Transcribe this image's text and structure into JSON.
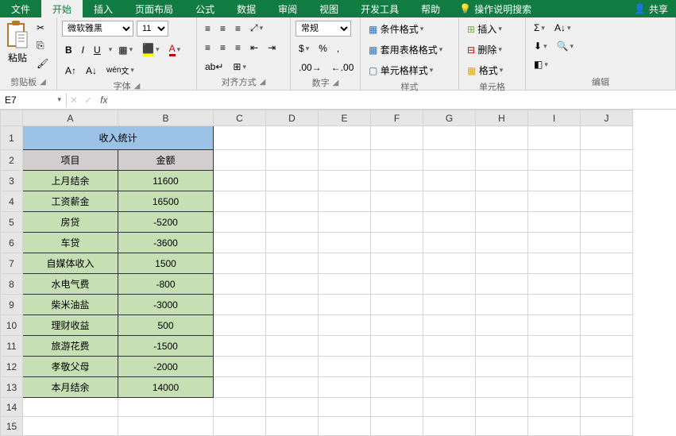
{
  "tabs": {
    "items": [
      "文件",
      "开始",
      "插入",
      "页面布局",
      "公式",
      "数据",
      "审阅",
      "视图",
      "开发工具",
      "帮助"
    ],
    "active_index": 1,
    "search_hint": "操作说明搜索",
    "share": "共享"
  },
  "ribbon": {
    "clipboard": {
      "label": "剪贴板",
      "paste": "粘贴"
    },
    "font": {
      "label": "字体",
      "family": "微软雅黑",
      "size": "11",
      "bold": "B",
      "italic": "I",
      "underline": "U"
    },
    "alignment": {
      "label": "对齐方式",
      "wrap": "ab"
    },
    "number": {
      "label": "数字",
      "format": "常规",
      "percent": "%"
    },
    "styles": {
      "label": "样式",
      "cond": "条件格式",
      "tbl": "套用表格格式",
      "cell": "单元格样式"
    },
    "cells": {
      "label": "单元格",
      "insert": "插入",
      "delete": "删除",
      "format": "格式"
    },
    "editing": {
      "label": "编辑",
      "sigma": "Σ"
    }
  },
  "namebox": {
    "ref": "E7",
    "fx": "fx"
  },
  "sheet": {
    "columns": [
      "A",
      "B",
      "C",
      "D",
      "E",
      "F",
      "G",
      "H",
      "I",
      "J"
    ],
    "title": "收入统计",
    "headers": {
      "item": "项目",
      "amount": "金额"
    },
    "rows": [
      {
        "item": "上月结余",
        "amount": "11600"
      },
      {
        "item": "工资薪金",
        "amount": "16500"
      },
      {
        "item": "房贷",
        "amount": "-5200"
      },
      {
        "item": "车贷",
        "amount": "-3600"
      },
      {
        "item": "自媒体收入",
        "amount": "1500"
      },
      {
        "item": "水电气费",
        "amount": "-800"
      },
      {
        "item": "柴米油盐",
        "amount": "-3000"
      },
      {
        "item": "理财收益",
        "amount": "500"
      },
      {
        "item": "旅游花费",
        "amount": "-1500"
      },
      {
        "item": "孝敬父母",
        "amount": "-2000"
      },
      {
        "item": "本月结余",
        "amount": "14000"
      }
    ]
  },
  "chart_data": {
    "type": "table",
    "title": "收入统计",
    "columns": [
      "项目",
      "金额"
    ],
    "rows": [
      [
        "上月结余",
        11600
      ],
      [
        "工资薪金",
        16500
      ],
      [
        "房贷",
        -5200
      ],
      [
        "车贷",
        -3600
      ],
      [
        "自媒体收入",
        1500
      ],
      [
        "水电气费",
        -800
      ],
      [
        "柴米油盐",
        -3000
      ],
      [
        "理财收益",
        500
      ],
      [
        "旅游花费",
        -1500
      ],
      [
        "孝敬父母",
        -2000
      ],
      [
        "本月结余",
        14000
      ]
    ]
  }
}
